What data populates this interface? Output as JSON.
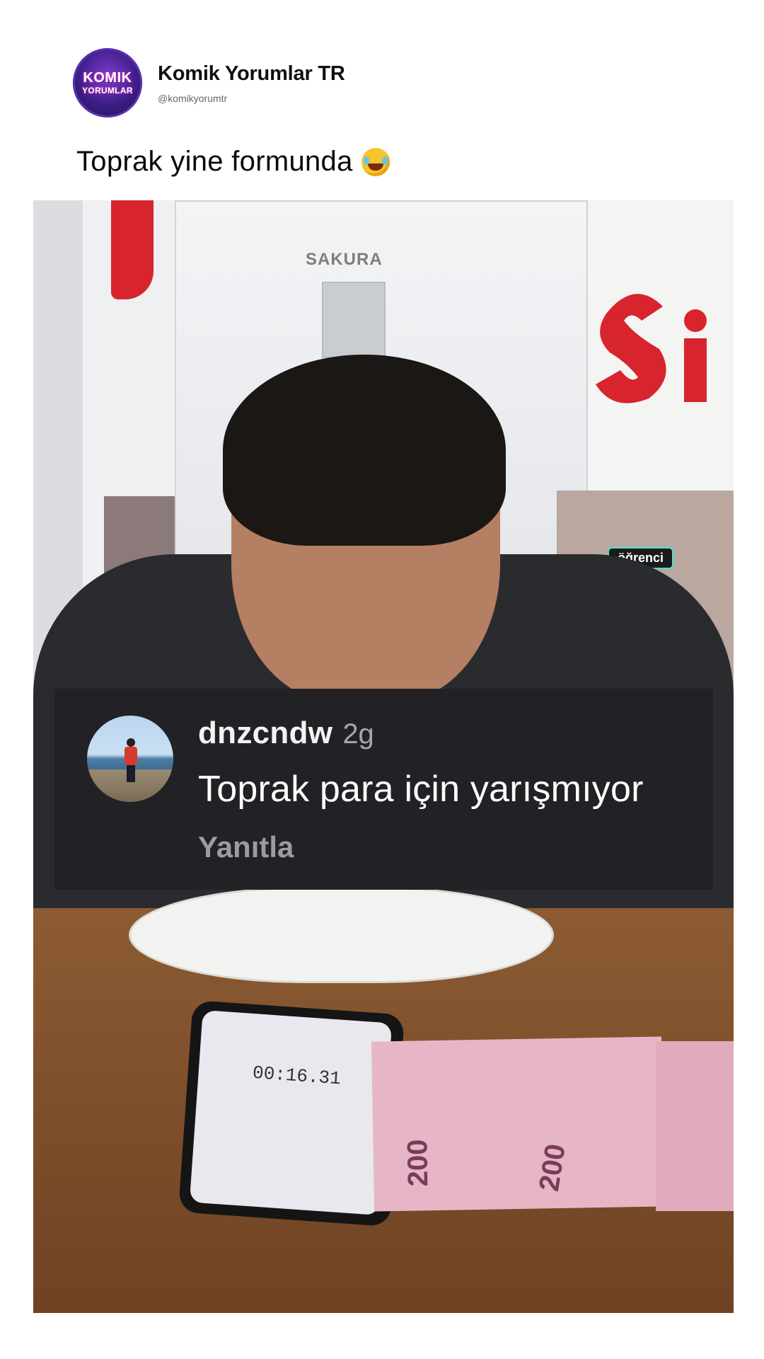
{
  "post": {
    "author": {
      "display_name": "Komik Yorumlar TR",
      "handle": "@komikyorumtr",
      "avatar_logo": [
        "KOMIK",
        "YORUMLAR"
      ]
    },
    "caption": "Toprak yine formunda",
    "caption_emoji": "face-with-tears-of-joy-icon"
  },
  "video": {
    "brand_text": "SAKURA",
    "badge_text": "öğrenci",
    "timer_text": "00:16.31",
    "banknote_value": "200"
  },
  "comment": {
    "username": "dnzcndw",
    "time": "2g",
    "text": "Toprak para için yarışmıyor",
    "reply_label": "Yanıtla"
  },
  "colors": {
    "comment_bg": "#222226",
    "muted_text": "#9b9ba0",
    "caption_text": "#0a0a0a"
  }
}
